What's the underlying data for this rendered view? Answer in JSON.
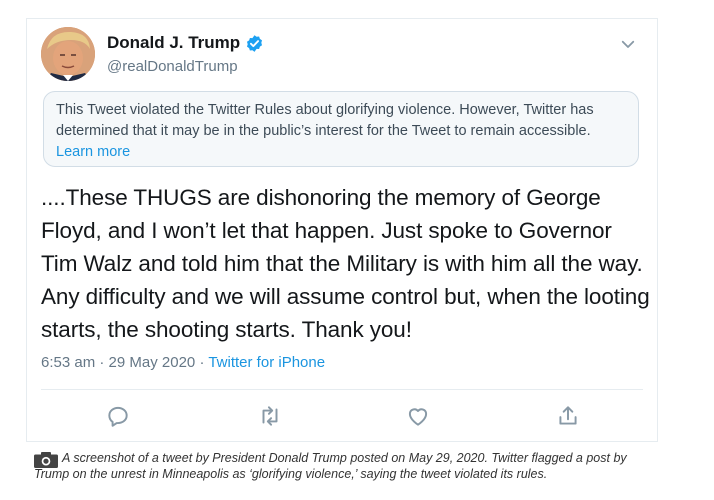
{
  "tweet": {
    "display_name": "Donald J. Trump",
    "handle": "@realDonaldTrump",
    "notice_text": "This Tweet violated the Twitter Rules about glorifying violence. However, Twitter has determined that it may be in the public’s interest for the Tweet to remain accessible.",
    "notice_link": "Learn more",
    "body": "....These THUGS are dishonoring the memory of George Floyd, and I won’t let that happen. Just spoke to Governor Tim Walz and told him that the Military is with him all the way. Any difficulty and we will assume control but, when the looting starts, the shooting starts. Thank you!",
    "timestamp": "6:53 am · 29 May 2020",
    "separator": "·",
    "source": "Twitter for iPhone",
    "icons": [
      "verified-badge-icon",
      "chevron-down-icon",
      "reply-icon",
      "retweet-icon",
      "like-icon",
      "share-icon"
    ],
    "colors": {
      "accent": "#1b95e0",
      "secondary_text": "#657786",
      "primary_text": "#14171a",
      "notice_bg": "#f5f8fa"
    }
  },
  "caption": {
    "icon": "camera-icon",
    "text": "A screenshot of a tweet by President Donald Trump posted on May 29, 2020. Twitter flagged a post by Trump on the unrest in Minneapolis as ‘glorifying violence,’ saying the tweet violated its rules."
  }
}
